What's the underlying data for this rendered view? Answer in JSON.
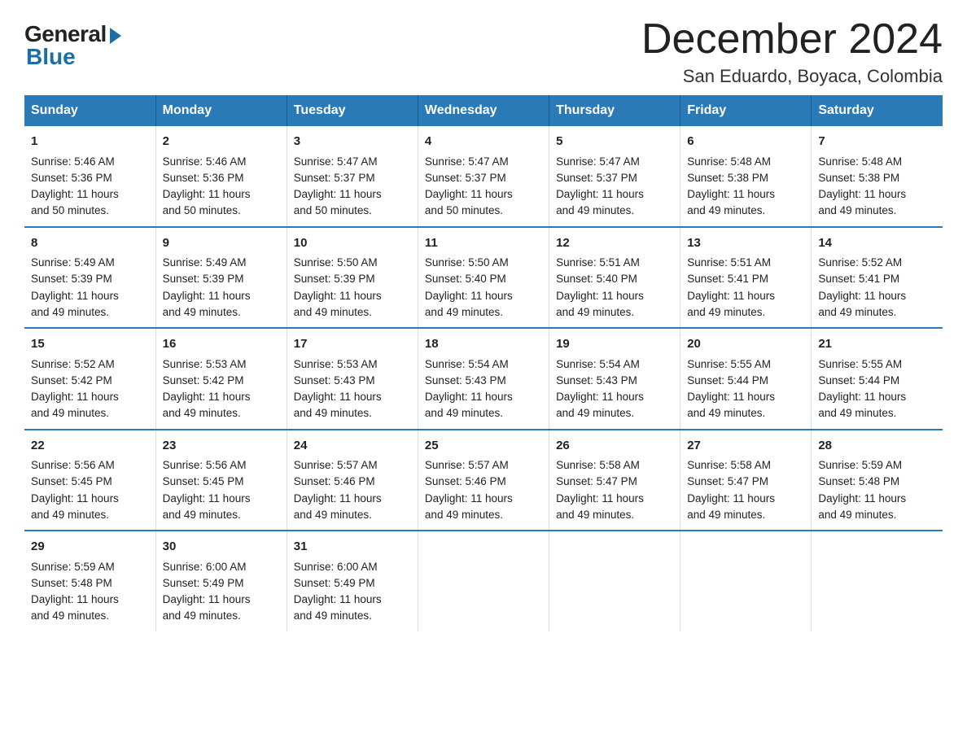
{
  "logo": {
    "general": "General",
    "blue": "Blue"
  },
  "title": "December 2024",
  "subtitle": "San Eduardo, Boyaca, Colombia",
  "days_header": [
    "Sunday",
    "Monday",
    "Tuesday",
    "Wednesday",
    "Thursday",
    "Friday",
    "Saturday"
  ],
  "weeks": [
    [
      {
        "day": "1",
        "info": "Sunrise: 5:46 AM\nSunset: 5:36 PM\nDaylight: 11 hours\nand 50 minutes."
      },
      {
        "day": "2",
        "info": "Sunrise: 5:46 AM\nSunset: 5:36 PM\nDaylight: 11 hours\nand 50 minutes."
      },
      {
        "day": "3",
        "info": "Sunrise: 5:47 AM\nSunset: 5:37 PM\nDaylight: 11 hours\nand 50 minutes."
      },
      {
        "day": "4",
        "info": "Sunrise: 5:47 AM\nSunset: 5:37 PM\nDaylight: 11 hours\nand 50 minutes."
      },
      {
        "day": "5",
        "info": "Sunrise: 5:47 AM\nSunset: 5:37 PM\nDaylight: 11 hours\nand 49 minutes."
      },
      {
        "day": "6",
        "info": "Sunrise: 5:48 AM\nSunset: 5:38 PM\nDaylight: 11 hours\nand 49 minutes."
      },
      {
        "day": "7",
        "info": "Sunrise: 5:48 AM\nSunset: 5:38 PM\nDaylight: 11 hours\nand 49 minutes."
      }
    ],
    [
      {
        "day": "8",
        "info": "Sunrise: 5:49 AM\nSunset: 5:39 PM\nDaylight: 11 hours\nand 49 minutes."
      },
      {
        "day": "9",
        "info": "Sunrise: 5:49 AM\nSunset: 5:39 PM\nDaylight: 11 hours\nand 49 minutes."
      },
      {
        "day": "10",
        "info": "Sunrise: 5:50 AM\nSunset: 5:39 PM\nDaylight: 11 hours\nand 49 minutes."
      },
      {
        "day": "11",
        "info": "Sunrise: 5:50 AM\nSunset: 5:40 PM\nDaylight: 11 hours\nand 49 minutes."
      },
      {
        "day": "12",
        "info": "Sunrise: 5:51 AM\nSunset: 5:40 PM\nDaylight: 11 hours\nand 49 minutes."
      },
      {
        "day": "13",
        "info": "Sunrise: 5:51 AM\nSunset: 5:41 PM\nDaylight: 11 hours\nand 49 minutes."
      },
      {
        "day": "14",
        "info": "Sunrise: 5:52 AM\nSunset: 5:41 PM\nDaylight: 11 hours\nand 49 minutes."
      }
    ],
    [
      {
        "day": "15",
        "info": "Sunrise: 5:52 AM\nSunset: 5:42 PM\nDaylight: 11 hours\nand 49 minutes."
      },
      {
        "day": "16",
        "info": "Sunrise: 5:53 AM\nSunset: 5:42 PM\nDaylight: 11 hours\nand 49 minutes."
      },
      {
        "day": "17",
        "info": "Sunrise: 5:53 AM\nSunset: 5:43 PM\nDaylight: 11 hours\nand 49 minutes."
      },
      {
        "day": "18",
        "info": "Sunrise: 5:54 AM\nSunset: 5:43 PM\nDaylight: 11 hours\nand 49 minutes."
      },
      {
        "day": "19",
        "info": "Sunrise: 5:54 AM\nSunset: 5:43 PM\nDaylight: 11 hours\nand 49 minutes."
      },
      {
        "day": "20",
        "info": "Sunrise: 5:55 AM\nSunset: 5:44 PM\nDaylight: 11 hours\nand 49 minutes."
      },
      {
        "day": "21",
        "info": "Sunrise: 5:55 AM\nSunset: 5:44 PM\nDaylight: 11 hours\nand 49 minutes."
      }
    ],
    [
      {
        "day": "22",
        "info": "Sunrise: 5:56 AM\nSunset: 5:45 PM\nDaylight: 11 hours\nand 49 minutes."
      },
      {
        "day": "23",
        "info": "Sunrise: 5:56 AM\nSunset: 5:45 PM\nDaylight: 11 hours\nand 49 minutes."
      },
      {
        "day": "24",
        "info": "Sunrise: 5:57 AM\nSunset: 5:46 PM\nDaylight: 11 hours\nand 49 minutes."
      },
      {
        "day": "25",
        "info": "Sunrise: 5:57 AM\nSunset: 5:46 PM\nDaylight: 11 hours\nand 49 minutes."
      },
      {
        "day": "26",
        "info": "Sunrise: 5:58 AM\nSunset: 5:47 PM\nDaylight: 11 hours\nand 49 minutes."
      },
      {
        "day": "27",
        "info": "Sunrise: 5:58 AM\nSunset: 5:47 PM\nDaylight: 11 hours\nand 49 minutes."
      },
      {
        "day": "28",
        "info": "Sunrise: 5:59 AM\nSunset: 5:48 PM\nDaylight: 11 hours\nand 49 minutes."
      }
    ],
    [
      {
        "day": "29",
        "info": "Sunrise: 5:59 AM\nSunset: 5:48 PM\nDaylight: 11 hours\nand 49 minutes."
      },
      {
        "day": "30",
        "info": "Sunrise: 6:00 AM\nSunset: 5:49 PM\nDaylight: 11 hours\nand 49 minutes."
      },
      {
        "day": "31",
        "info": "Sunrise: 6:00 AM\nSunset: 5:49 PM\nDaylight: 11 hours\nand 49 minutes."
      },
      {
        "day": "",
        "info": ""
      },
      {
        "day": "",
        "info": ""
      },
      {
        "day": "",
        "info": ""
      },
      {
        "day": "",
        "info": ""
      }
    ]
  ]
}
